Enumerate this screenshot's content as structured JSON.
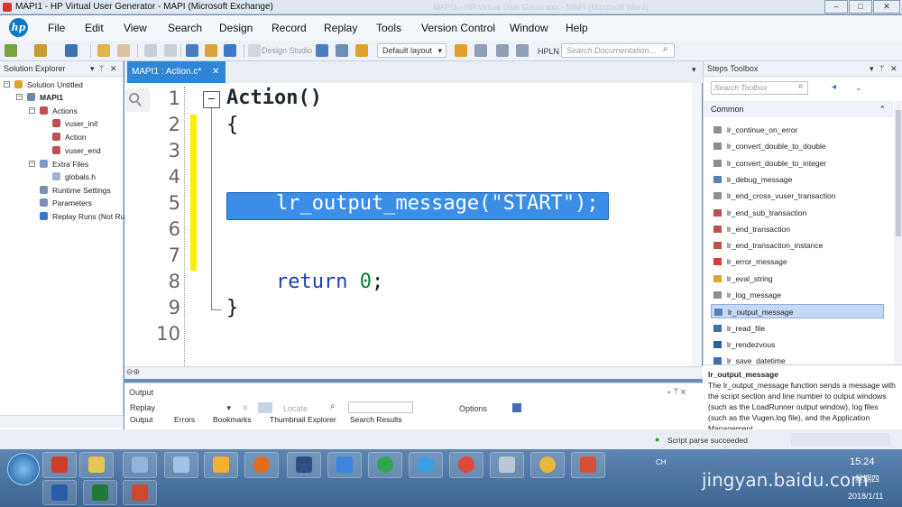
{
  "window": {
    "title": "MAPI1 - HP Virtual User Generator - MAPI (Microsoft Exchange)",
    "title_faded": "MAPI1 - HP Virtual User Generator - MAPI (Microsoft Word)",
    "controls": [
      "–",
      "□",
      "✕"
    ]
  },
  "menu": [
    "File",
    "Edit",
    "View",
    "Search",
    "Design",
    "Record",
    "Replay",
    "Tools",
    "Version Control",
    "Window",
    "Help"
  ],
  "toolbar": {
    "design_studio": "Design Studio",
    "layout": "Default layout",
    "hpln": "HPLN",
    "search_placeholder": "Search Documentation..."
  },
  "solution_explorer": {
    "title": "Solution Explorer",
    "items": [
      {
        "label": "Solution Untitled",
        "level": 0
      },
      {
        "label": "MAPI1",
        "level": 1,
        "bold": true
      },
      {
        "label": "Actions",
        "level": 2
      },
      {
        "label": "vuser_init",
        "level": 3
      },
      {
        "label": "Action",
        "level": 3
      },
      {
        "label": "vuser_end",
        "level": 3
      },
      {
        "label": "Extra Files",
        "level": 2
      },
      {
        "label": "globals.h",
        "level": 3
      },
      {
        "label": "Runtime Settings",
        "level": 2
      },
      {
        "label": "Parameters",
        "level": 2
      },
      {
        "label": "Replay Runs (Not Run",
        "level": 2
      }
    ]
  },
  "editor": {
    "tab": "MAPI1 : Action.c*",
    "line_numbers": [
      "1",
      "2",
      "3",
      "4",
      "5",
      "6",
      "7",
      "8",
      "9",
      "10"
    ],
    "code": {
      "l1": "Action()",
      "l2": "{",
      "l5": "lr_output_message(\"START\");",
      "l8_kw": "return",
      "l8_num": "0",
      "l8_end": ";",
      "l9": "}"
    }
  },
  "output": {
    "title": "Output",
    "replay": "Replay",
    "locate": "Locate",
    "options": "Options",
    "tabs": [
      "Output",
      "Errors",
      "Bookmarks",
      "Thumbnail Explorer",
      "Search Results"
    ]
  },
  "steps_toolbox": {
    "title": "Steps Toolbox",
    "search_placeholder": "Search Toolbox",
    "category": "Common",
    "items": [
      "lr_continue_on_error",
      "lr_convert_double_to_double",
      "lr_convert_double_to_integer",
      "lr_debug_message",
      "lr_end_cross_vuser_transaction",
      "lr_end_sub_transaction",
      "lr_end_transaction",
      "lr_end_transaction_instance",
      "lr_error_message",
      "lr_eval_string",
      "lr_log_message",
      "lr_output_message",
      "lr_read_file",
      "lr_rendezvous",
      "lr_save_datetime"
    ],
    "selected": "lr_output_message",
    "desc_title": "lr_output_message",
    "desc_text": "The lr_output_message function sends a message with the script section and line number to output windows (such as the LoadRunner output window), log files (such as the Vugen.log file), and the Application Management"
  },
  "status": {
    "text": "Script parse succeeded"
  },
  "taskbar": {
    "lang": "CH",
    "time": "15:24",
    "day": "星期四",
    "date": "2018/1/11"
  },
  "watermark": "jingyan.baidu.com"
}
